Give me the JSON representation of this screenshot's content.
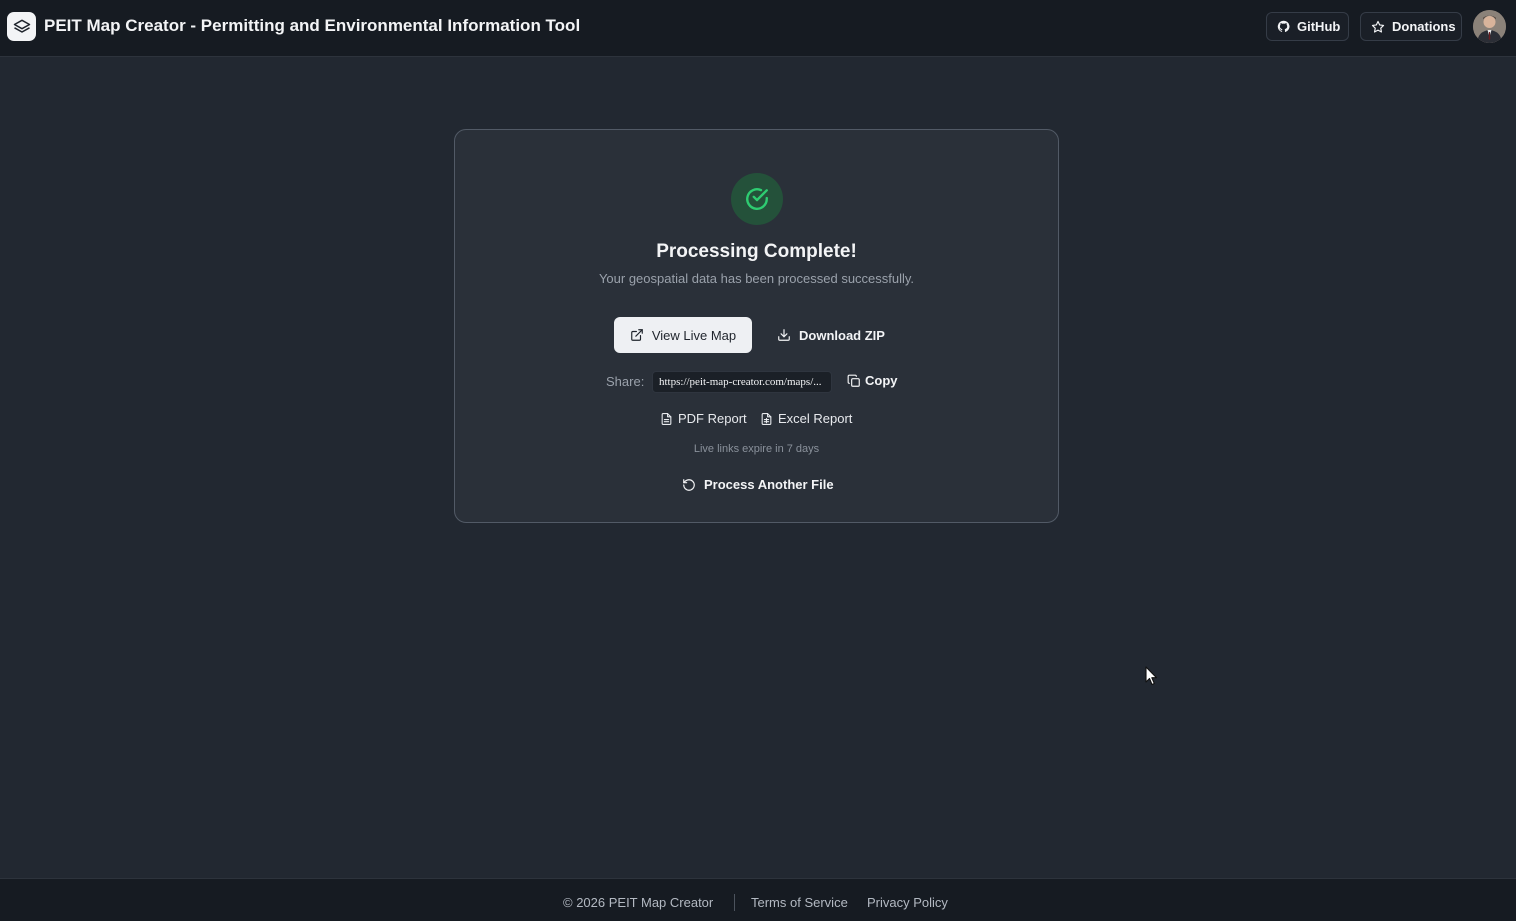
{
  "header": {
    "logo_icon": "layers-logo-icon",
    "title": "PEIT Map Creator - Permitting and Environmental Information Tool",
    "github_label": "GitHub",
    "github_icon": "github-icon",
    "donations_label": "Donations",
    "donations_icon": "star-icon",
    "avatar_icon": "user-avatar"
  },
  "card": {
    "success_icon": "check-circle-icon",
    "title": "Processing Complete!",
    "subtitle": "Your geospatial data has been processed successfully.",
    "view_live_map_label": "View Live Map",
    "view_live_map_icon": "external-link-icon",
    "download_zip_label": "Download ZIP",
    "download_zip_icon": "download-icon",
    "share_label": "Share:",
    "share_url": "https://peit-map-creator.com/maps/...",
    "copy_label": "Copy",
    "copy_icon": "copy-icon",
    "pdf_report_label": "PDF Report",
    "excel_report_label": "Excel Report",
    "report_icon": "file-text-icon",
    "expire_note": "Live links expire in 7 days",
    "process_another_label": "Process Another File",
    "process_another_icon": "rotate-ccw-icon"
  },
  "footer": {
    "copyright": "© 2026 PEIT Map Creator",
    "terms_label": "Terms of Service",
    "privacy_label": "Privacy Policy"
  },
  "colors": {
    "background": "#222831",
    "header_bg": "#161b22",
    "card_bg": "#2a3039",
    "success_green": "#2ecc71",
    "primary_button_bg": "#eef0f3"
  }
}
